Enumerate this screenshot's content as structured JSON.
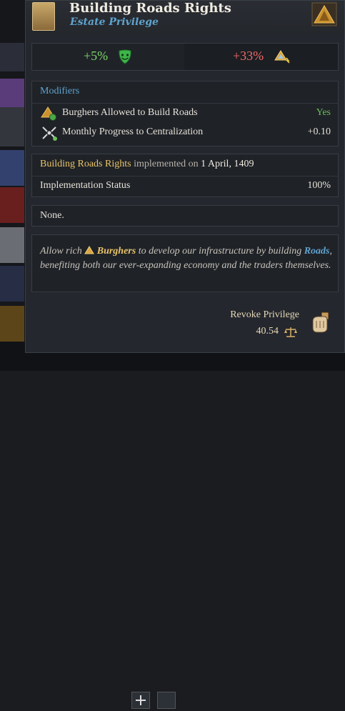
{
  "header": {
    "title": "Building Roads Rights",
    "subtitle": "Estate Privilege"
  },
  "impacts": {
    "left_value": "+5%",
    "left_icon": "happy-mask-icon",
    "right_value": "+33%",
    "right_icon": "estate-power-icon"
  },
  "modifiers": {
    "heading": "Modifiers",
    "rows": [
      {
        "label": "Burghers Allowed to Build Roads",
        "value": "Yes",
        "icon": "burghers-road-icon"
      },
      {
        "label": "Monthly Progress to Centralization",
        "value": "+0.10",
        "icon": "centralization-icon"
      }
    ]
  },
  "implementation": {
    "name": "Building Roads Rights",
    "middle": "implemented on",
    "date": "1 April, 1409",
    "status_label": "Implementation Status",
    "status_value": "100%"
  },
  "requirements": {
    "text": "None."
  },
  "description": {
    "part1": "Allow rich",
    "burghers": "Burghers",
    "part2": "to develop our infrastructure by building",
    "roads": "Roads",
    "part3": ", benefiting both our ever-expanding economy and the traders themselves."
  },
  "revoke": {
    "label": "Revoke Privilege",
    "cost": "40.54",
    "cost_icon": "stability-scales-icon",
    "button_icon": "revoke-hand-icon"
  },
  "colors": {
    "accent_blue": "#5fa3cf",
    "positive_green": "#7ed66a",
    "negative_red": "#ef6a6a",
    "gold": "#e9c46a"
  }
}
